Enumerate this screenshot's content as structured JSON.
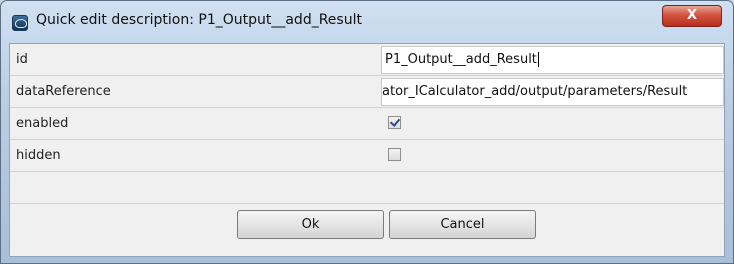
{
  "window": {
    "title": "Quick edit description: P1_Output__add_Result",
    "close_label": "X"
  },
  "fields": [
    {
      "label": "id",
      "type": "text",
      "value": "P1_Output__add_Result"
    },
    {
      "label": "dataReference",
      "type": "text",
      "value": "ator_ICalculator_add/output/parameters/Result"
    },
    {
      "label": "enabled",
      "type": "checkbox",
      "checked": true
    },
    {
      "label": "hidden",
      "type": "checkbox",
      "checked": false
    }
  ],
  "buttons": {
    "ok_label": "Ok",
    "cancel_label": "Cancel"
  }
}
